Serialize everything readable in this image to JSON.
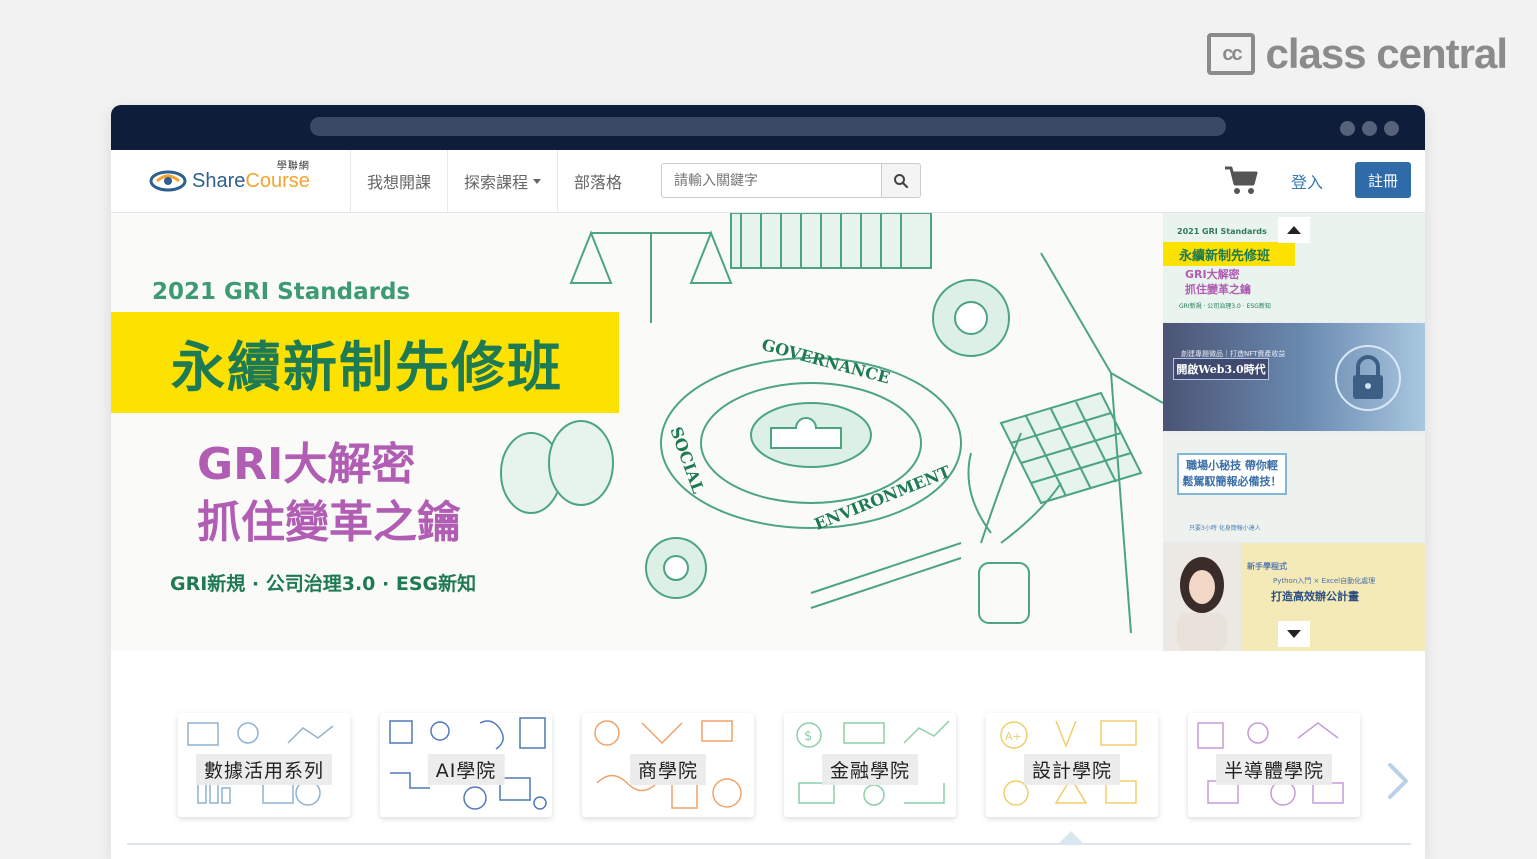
{
  "watermark": {
    "cc_mark": "cc",
    "text": "class central"
  },
  "navbar": {
    "logo_share": "Share",
    "logo_course": "Course",
    "logo_cn": "學聯網",
    "items": [
      {
        "label": "我想開課"
      },
      {
        "label": "探索課程"
      },
      {
        "label": "部落格"
      }
    ],
    "search_placeholder": "請輸入關鍵字",
    "login": "登入",
    "register": "註冊"
  },
  "banner": {
    "standards": "2021 GRI Standards",
    "title": "永續新制先修班",
    "subtitle_1": "GRI大解密",
    "subtitle_2": "抓住變革之鑰",
    "tags": "GRI新規 · 公司治理3.0 · ESG新知",
    "art_words": [
      "GOVERNANCE",
      "ENVIRONMENT",
      "SOCIAL"
    ]
  },
  "thumbnails": [
    {
      "std": "2021 GRI Standards",
      "title": "永續新制先修班",
      "line1": "GRI大解密",
      "line2": "抓住變革之鑰",
      "tags": "GRI新規 · 公司治理3.0 · ESG新知"
    },
    {
      "top": "創建專題微品｜打造NFT資產收益",
      "title": "開啟Web3.0時代"
    },
    {
      "title": "職場小秘技 帶你輕鬆駕馭簡報必備技！",
      "sub": "只要3小時 化身簡報小達人"
    },
    {
      "a": "新手學程式",
      "b": "Python入門 × Excel自動化處理",
      "c": "打造高效辦公計畫"
    }
  ],
  "categories": [
    {
      "label": "數據活用系列",
      "color": "#8fb2cf"
    },
    {
      "label": "AI學院",
      "color": "#4f79b8"
    },
    {
      "label": "商學院",
      "color": "#f0a368"
    },
    {
      "label": "金融學院",
      "color": "#8ccfa8"
    },
    {
      "label": "設計學院",
      "color": "#f0cf6a"
    },
    {
      "label": "半導體學院",
      "color": "#c79ad8"
    }
  ],
  "colors": {
    "accent": "#2e6ba8",
    "banner_green": "#1d7a52",
    "banner_yellow": "#fde100",
    "banner_purple": "#b05db3",
    "chrome": "#0e1d3a"
  }
}
